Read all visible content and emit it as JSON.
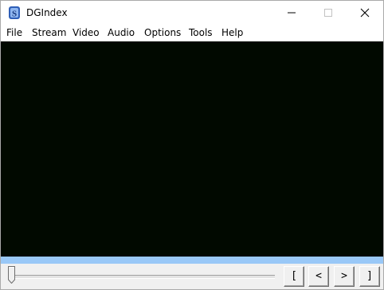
{
  "window": {
    "title": "DGIndex"
  },
  "menu": {
    "items": [
      "File",
      "Stream",
      "Video",
      "Audio",
      "Options",
      "Tools",
      "Help"
    ]
  },
  "icons": {
    "app": "dgindex-app-icon",
    "minimize": "minimize-icon",
    "maximize": "maximize-icon",
    "close": "close-icon"
  },
  "progress": {
    "fraction": 1.0
  },
  "timeline": {
    "position_fraction": 0.0
  },
  "controls": {
    "set_start_label": "[",
    "prev_label": "<",
    "next_label": ">",
    "set_end_label": "]"
  },
  "colors": {
    "video_background": "#010900",
    "progress_fill": "#99c8f7"
  }
}
